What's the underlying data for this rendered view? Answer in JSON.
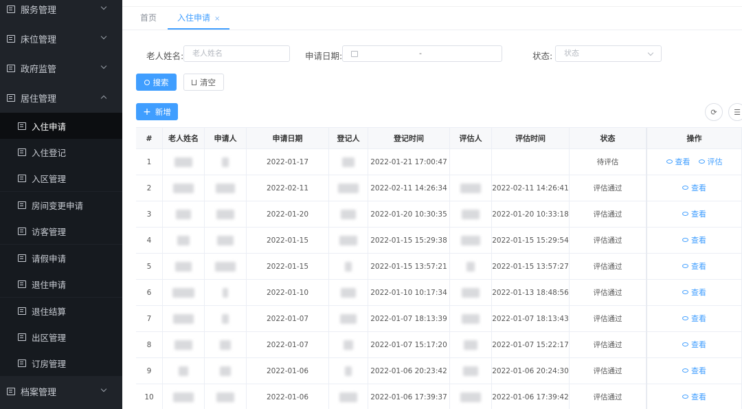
{
  "sidebar": {
    "items": [
      {
        "label": "服务管理",
        "expanded": false
      },
      {
        "label": "床位管理",
        "expanded": false
      },
      {
        "label": "政府监管",
        "expanded": false
      },
      {
        "label": "居住管理",
        "expanded": true
      },
      {
        "label": "档案管理",
        "expanded": false
      }
    ],
    "sub_items": [
      {
        "label": "入住申请",
        "active": true
      },
      {
        "label": "入住登记"
      },
      {
        "label": "入区管理"
      },
      {
        "label": "房间变更申请"
      },
      {
        "label": "访客管理"
      },
      {
        "label": "请假申请"
      },
      {
        "label": "退住申请"
      },
      {
        "label": "退住结算"
      },
      {
        "label": "出区管理"
      },
      {
        "label": "订房管理"
      }
    ]
  },
  "tabs": {
    "home": "首页",
    "active": "入住申请",
    "close": "×"
  },
  "search": {
    "name_label": "老人姓名:",
    "name_placeholder": "老人姓名",
    "date_label": "申请日期:",
    "date_separator": "-",
    "status_label": "状态:",
    "status_placeholder": "状态",
    "search_button": "搜索",
    "clear_button": "清空"
  },
  "toolbar": {
    "add_button": "新增"
  },
  "table": {
    "headers": [
      "#",
      "老人姓名",
      "申请人",
      "申请日期",
      "登记人",
      "登记时间",
      "评估人",
      "评估时间",
      "状态",
      "操作"
    ],
    "actions": {
      "view": "查看",
      "evaluate": "评估"
    },
    "rows": [
      {
        "index": "1",
        "name": "",
        "applicant": "",
        "apply_date": "2022-01-17",
        "registrar": "",
        "register_time": "2022-01-21 17:00:47",
        "evaluator": "",
        "eval_time": "",
        "status": "待评估"
      },
      {
        "index": "2",
        "name": "",
        "applicant": "",
        "apply_date": "2022-02-11",
        "registrar": "",
        "register_time": "2022-02-11 14:26:34",
        "evaluator": "",
        "eval_time": "2022-02-11 14:26:41",
        "status": "评估通过"
      },
      {
        "index": "3",
        "name": "",
        "applicant": "",
        "apply_date": "2022-01-20",
        "registrar": "",
        "register_time": "2022-01-20 10:30:35",
        "evaluator": "",
        "eval_time": "2022-01-20 10:33:18",
        "status": "评估通过"
      },
      {
        "index": "4",
        "name": "",
        "applicant": "",
        "apply_date": "2022-01-15",
        "registrar": "",
        "register_time": "2022-01-15 15:29:38",
        "evaluator": "",
        "eval_time": "2022-01-15 15:29:54",
        "status": "评估通过"
      },
      {
        "index": "5",
        "name": "",
        "applicant": "",
        "apply_date": "2022-01-15",
        "registrar": "",
        "register_time": "2022-01-15 13:57:21",
        "evaluator": "",
        "eval_time": "2022-01-15 13:57:27",
        "status": "评估通过"
      },
      {
        "index": "6",
        "name": "",
        "applicant": "",
        "apply_date": "2022-01-10",
        "registrar": "",
        "register_time": "2022-01-10 10:17:34",
        "evaluator": "",
        "eval_time": "2022-01-13 18:48:56",
        "status": "评估通过"
      },
      {
        "index": "7",
        "name": "",
        "applicant": "",
        "apply_date": "2022-01-07",
        "registrar": "",
        "register_time": "2022-01-07 18:13:39",
        "evaluator": "",
        "eval_time": "2022-01-07 18:13:43",
        "status": "评估通过"
      },
      {
        "index": "8",
        "name": "",
        "applicant": "",
        "apply_date": "2022-01-07",
        "registrar": "",
        "register_time": "2022-01-07 15:17:20",
        "evaluator": "",
        "eval_time": "2022-01-07 15:22:17",
        "status": "评估通过"
      },
      {
        "index": "9",
        "name": "",
        "applicant": "",
        "apply_date": "2022-01-06",
        "registrar": "",
        "register_time": "2022-01-06 20:23:42",
        "evaluator": "",
        "eval_time": "2022-01-06 20:24:30",
        "status": "评估通过"
      },
      {
        "index": "10",
        "name": "",
        "applicant": "",
        "apply_date": "2022-01-06",
        "registrar": "",
        "register_time": "2022-01-06 17:39:37",
        "evaluator": "",
        "eval_time": "2022-01-06 17:39:42",
        "status": "评估通过"
      }
    ]
  },
  "colors": {
    "sidebar_bg": "#1f2329",
    "accent": "#409eff"
  }
}
